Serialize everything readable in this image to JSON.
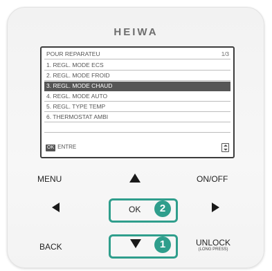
{
  "brand": "HEIWA",
  "screen": {
    "title": "POUR REPARATEU",
    "page": "1/3",
    "items": [
      {
        "label": "1. REGL. MODE ECS"
      },
      {
        "label": "2. REGL. MODE FROID"
      },
      {
        "label": "3. REGL. MODE CHAUD",
        "selected": true
      },
      {
        "label": "4. REGL. MODE AUTO"
      },
      {
        "label": "5. REGL. TYPE TEMP"
      },
      {
        "label": "6. THERMOSTAT AMBI"
      }
    ],
    "footer_ok": "OK",
    "footer_label": "ENTRE"
  },
  "buttons": {
    "menu": "MENU",
    "on_off": "ON/OFF",
    "ok": "OK",
    "back": "BACK",
    "unlock": "UNLOCK",
    "unlock_sub": "(LONG PRESS)"
  },
  "badges": {
    "ok": "2",
    "down": "1"
  },
  "colors": {
    "highlight": "#2f9e8c",
    "selected_row": "#565656"
  },
  "icons": [
    "up-arrow-icon",
    "down-arrow-icon",
    "left-arrow-icon",
    "right-arrow-icon",
    "scroll-updown-icon"
  ]
}
